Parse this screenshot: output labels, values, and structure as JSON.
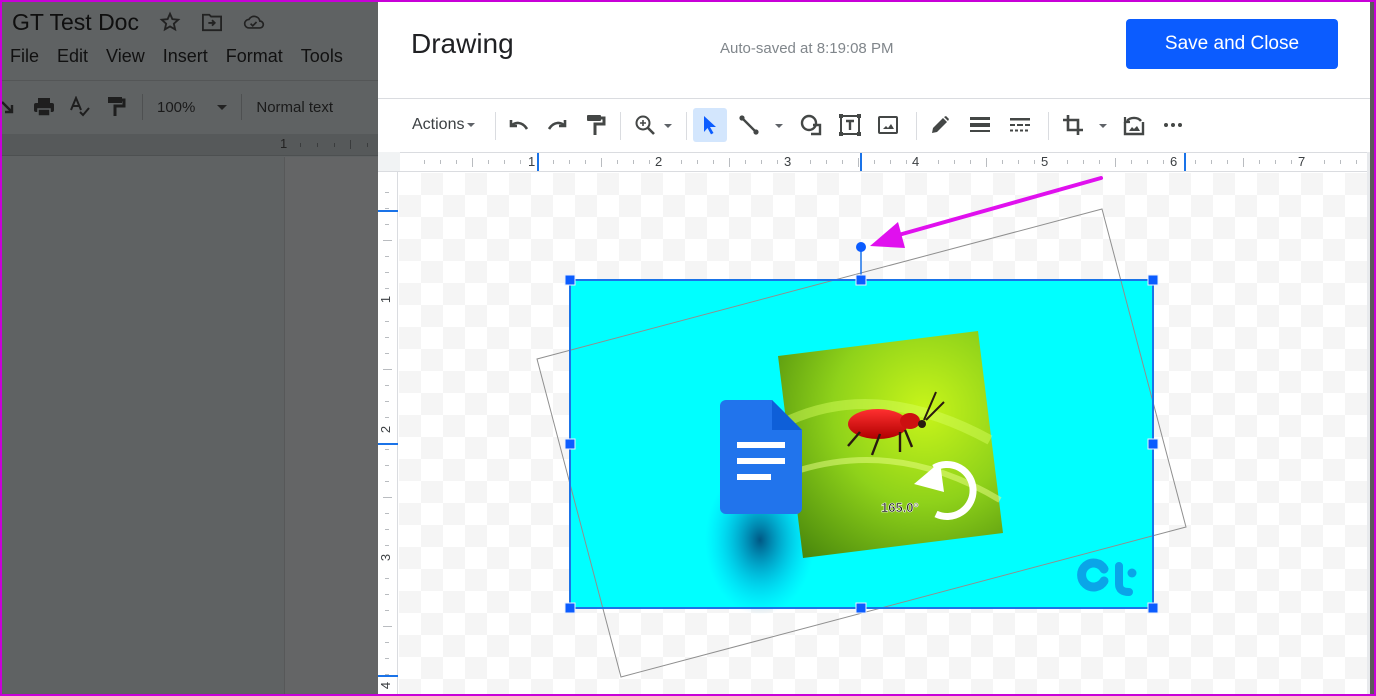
{
  "doc": {
    "title": "GT Test Doc",
    "menu": [
      "File",
      "Edit",
      "View",
      "Insert",
      "Format",
      "Tools"
    ],
    "zoom": "100%",
    "style": "Normal text",
    "ruler_label": "1",
    "icons": [
      "star-icon",
      "move-to-folder-icon",
      "cloud-saved-icon"
    ]
  },
  "dialog": {
    "title": "Drawing",
    "autosave": "Auto-saved at 8:19:08 PM",
    "save_button": "Save and Close",
    "accent_color": "#0b5cff"
  },
  "toolbar": {
    "actions_label": "Actions",
    "tools": [
      {
        "name": "undo",
        "icon": "undo-icon"
      },
      {
        "name": "redo",
        "icon": "redo-icon"
      },
      {
        "name": "paint-format",
        "icon": "paint-roller-icon"
      },
      {
        "name": "zoom",
        "icon": "zoom-in-icon",
        "has_dropdown": true
      },
      {
        "name": "select",
        "icon": "cursor-arrow-icon",
        "active": true
      },
      {
        "name": "line",
        "icon": "line-icon",
        "has_dropdown": true
      },
      {
        "name": "shape",
        "icon": "shape-icon"
      },
      {
        "name": "text-box",
        "icon": "text-box-icon"
      },
      {
        "name": "image",
        "icon": "image-icon"
      },
      {
        "name": "border-color",
        "icon": "pencil-icon"
      },
      {
        "name": "border-weight",
        "icon": "line-weight-icon"
      },
      {
        "name": "border-dash",
        "icon": "line-dash-icon"
      },
      {
        "name": "crop",
        "icon": "crop-icon",
        "has_dropdown": true
      },
      {
        "name": "reset-image",
        "icon": "reset-image-icon"
      },
      {
        "name": "more",
        "icon": "more-horizontal-icon"
      }
    ]
  },
  "rulers": {
    "horizontal": [
      "1",
      "2",
      "3",
      "4",
      "5",
      "6",
      "7"
    ],
    "vertical": [
      "1",
      "2",
      "3",
      "4"
    ]
  },
  "canvas": {
    "image_label": "165.0°",
    "rotation_degrees": 165.0,
    "logo_text": "Gt",
    "image_bg_color": "#00ffff",
    "annotation_arrow_color": "#e010ee"
  }
}
